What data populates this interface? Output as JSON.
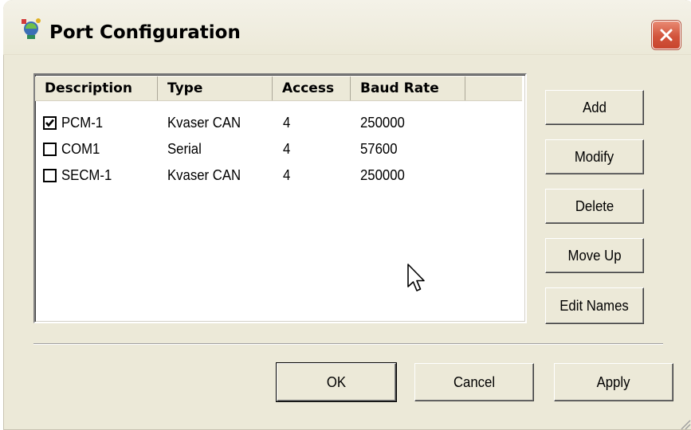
{
  "window": {
    "title": "Port Configuration",
    "icons": {
      "app": "port-config-icon",
      "close": "close-icon"
    },
    "accent_close": "#d2543c"
  },
  "table": {
    "columns": [
      "Description",
      "Type",
      "Access",
      "Baud Rate"
    ],
    "rows": [
      {
        "checked": true,
        "description": "PCM-1",
        "type": "Kvaser CAN",
        "access": "4",
        "baud_rate": "250000"
      },
      {
        "checked": false,
        "description": "COM1",
        "type": "Serial",
        "access": "4",
        "baud_rate": "57600"
      },
      {
        "checked": false,
        "description": "SECM-1",
        "type": "Kvaser CAN",
        "access": "4",
        "baud_rate": "250000"
      }
    ]
  },
  "side_buttons": {
    "add": "Add",
    "modify": "Modify",
    "delete": "Delete",
    "move_up": "Move Up",
    "edit_names": "Edit Names"
  },
  "footer_buttons": {
    "ok": "OK",
    "cancel": "Cancel",
    "apply": "Apply"
  }
}
